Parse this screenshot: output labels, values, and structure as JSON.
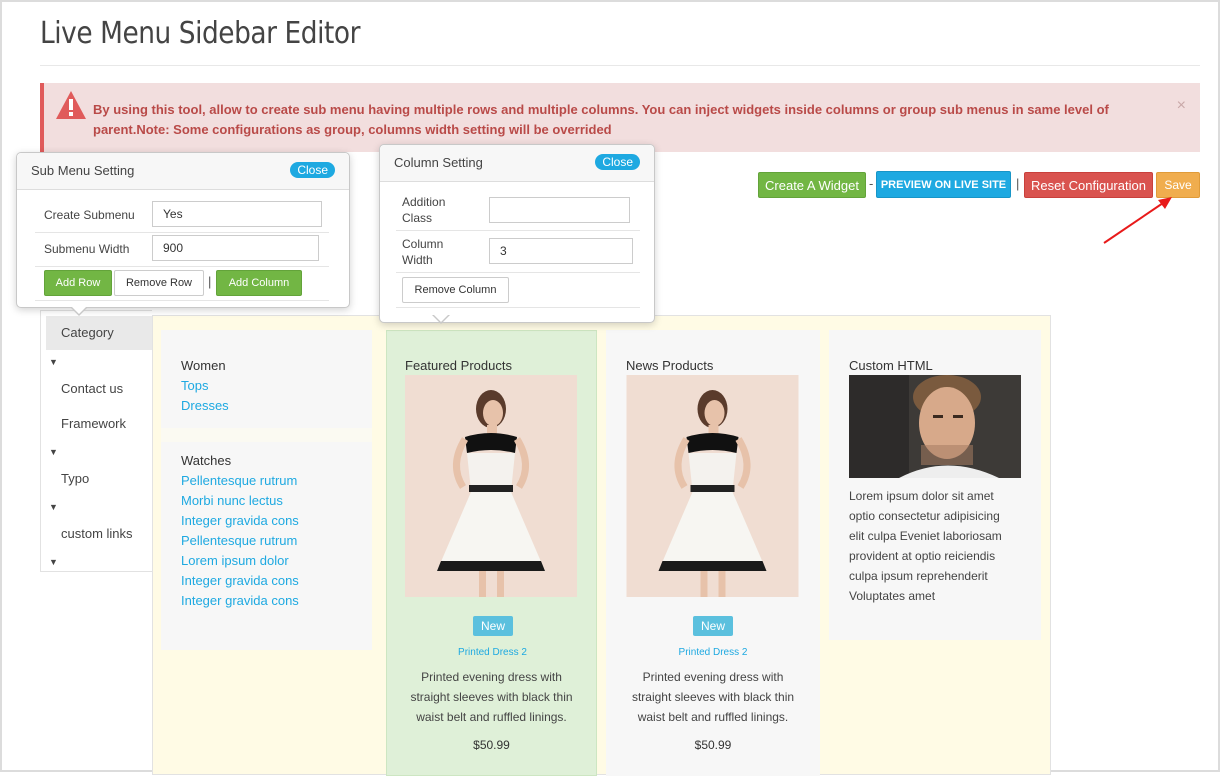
{
  "page": {
    "title": "Live Menu Sidebar Editor"
  },
  "alert": {
    "message": "By using this tool, allow to create sub menu having multiple rows and multiple columns. You can inject widgets inside columns or group sub menus in same level of parent.Note: Some configurations as group, columns width setting will be overrided",
    "close_label": "×"
  },
  "toolbar": {
    "create_widget": "Create A Widget",
    "dash": "-",
    "preview": "PREVIEW ON LIVE SITE",
    "pipe": "|",
    "reset": "Reset Configuration",
    "save": "Save"
  },
  "submenu_setting": {
    "title": "Sub Menu Setting",
    "close": "Close",
    "create_submenu_label": "Create Submenu",
    "create_submenu_value": "Yes",
    "submenu_width_label": "Submenu Width",
    "submenu_width_value": "900",
    "add_row": "Add Row",
    "remove_row": "Remove Row",
    "pipe": "|",
    "add_column": "Add Column"
  },
  "column_setting": {
    "title": "Column Setting",
    "close": "Close",
    "addition_class_label": "Addition Class",
    "addition_class_value": "",
    "column_width_label": "Column Width",
    "column_width_value": "3",
    "remove_column": "Remove Column"
  },
  "sidebar": {
    "items": [
      {
        "label": "Category"
      },
      {
        "label": "Contact us"
      },
      {
        "label": "Framework"
      },
      {
        "label": "Typo"
      },
      {
        "label": "custom links"
      }
    ]
  },
  "mega": {
    "col1": {
      "group1_title": "Women",
      "group1_links": [
        "Tops",
        "Dresses"
      ],
      "group2_title": "Watches",
      "group2_links": [
        "Pellentesque rutrum",
        "Morbi nunc lectus",
        "Integer gravida cons",
        "Pellentesque rutrum",
        "Lorem ipsum dolor",
        "Integer gravida cons",
        "Integer gravida cons"
      ]
    },
    "col2": {
      "title": "Featured Products",
      "badge": "New",
      "product_name": "Printed Dress 2",
      "description": [
        "Printed evening dress with",
        "straight sleeves with black thin",
        "waist belt and ruffled linings."
      ],
      "price": "$50.99"
    },
    "col3": {
      "title": "News Products",
      "badge": "New",
      "product_name": "Printed Dress 2",
      "description": [
        "Printed evening dress with",
        "straight sleeves with black thin",
        "waist belt and ruffled linings."
      ],
      "price": "$50.99"
    },
    "col4": {
      "title": "Custom HTML",
      "text": [
        "Lorem ipsum dolor sit amet",
        "optio consectetur adipisicing",
        "elit culpa Eveniet laboriosam",
        "provident at optio reiciendis",
        "culpa ipsum reprehenderit",
        "Voluptates amet"
      ]
    }
  },
  "colors": {
    "green": "#72b644",
    "blue": "#1ea9e1",
    "red": "#d9534f",
    "orange": "#f0ad4e",
    "alert_bg": "#f2dede",
    "alert_text": "#b94a48"
  },
  "icons": {
    "alert": "warning-triangle-icon",
    "arrow": "red-arrow-icon",
    "caret": "caret-down-icon"
  }
}
